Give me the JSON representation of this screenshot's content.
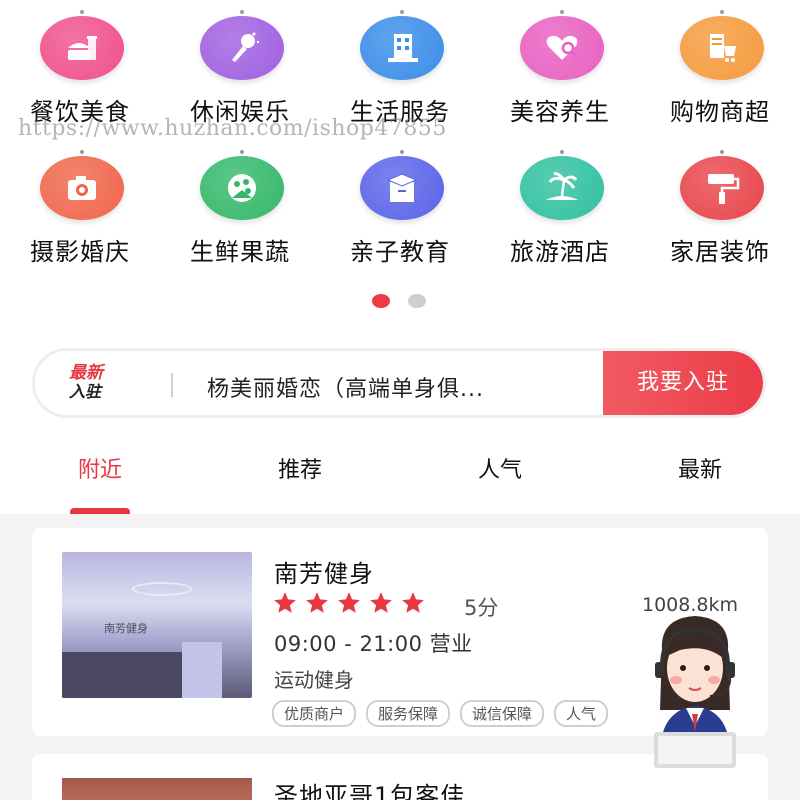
{
  "categories": [
    {
      "label": "餐饮美食",
      "icon": "food-icon",
      "color": "#f0508c"
    },
    {
      "label": "休闲娱乐",
      "icon": "microphone-icon",
      "color": "#a05fe0"
    },
    {
      "label": "生活服务",
      "icon": "building-icon",
      "color": "#3a8de8"
    },
    {
      "label": "美容养生",
      "icon": "heart-search-icon",
      "color": "#e85fc0"
    },
    {
      "label": "购物商超",
      "icon": "shopping-cart-icon",
      "color": "#f59a3c"
    },
    {
      "label": "摄影婚庆",
      "icon": "camera-icon",
      "color": "#f0654a"
    },
    {
      "label": "生鲜果蔬",
      "icon": "fruit-plate-icon",
      "color": "#33b86a"
    },
    {
      "label": "亲子教育",
      "icon": "graduation-book-icon",
      "color": "#5a63e8"
    },
    {
      "label": "旅游酒店",
      "icon": "palm-island-icon",
      "color": "#2fc0a0"
    },
    {
      "label": "家居装饰",
      "icon": "paint-roller-icon",
      "color": "#e8454a"
    }
  ],
  "watermark": "https://www.huzhan.com/ishop47855",
  "pager": {
    "current": 1,
    "total": 2
  },
  "notice": {
    "badge_top": "最新",
    "badge_bottom": "入驻",
    "text": "杨美丽婚恋（高端单身俱...",
    "button": "我要入驻"
  },
  "tabs": [
    {
      "label": "附近",
      "active": true
    },
    {
      "label": "推荐",
      "active": false
    },
    {
      "label": "人气",
      "active": false
    },
    {
      "label": "最新",
      "active": false
    }
  ],
  "shops": [
    {
      "name": "南芳健身",
      "thumb_sign": "南芳健身",
      "rating": 5,
      "score": "5分",
      "distance": "1008.8km",
      "hours": "09:00 - 21:00 营业",
      "category": "运动健身",
      "tags": [
        "优质商户",
        "服务保障",
        "诚信保障",
        "人气"
      ]
    },
    {
      "name": "圣地亚哥1包客佳"
    }
  ],
  "colors": {
    "accent": "#e83742",
    "star": "#e83742"
  }
}
